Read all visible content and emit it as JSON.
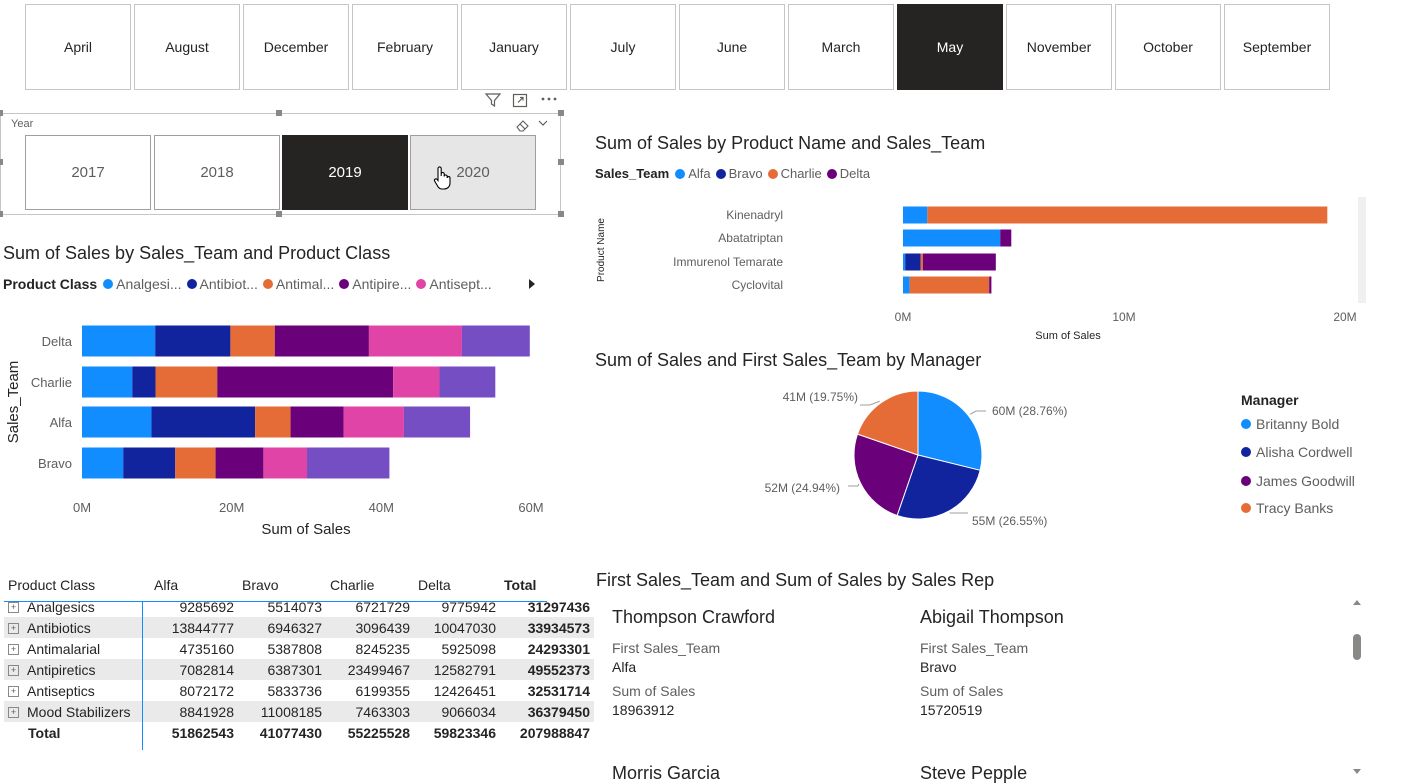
{
  "months": {
    "items": [
      "April",
      "August",
      "December",
      "February",
      "January",
      "July",
      "June",
      "March",
      "May",
      "November",
      "October",
      "September"
    ],
    "selected": "May"
  },
  "year_slicer": {
    "label": "Year",
    "years": [
      "2017",
      "2018",
      "2019",
      "2020"
    ],
    "selected": "2019",
    "hovered": "2020"
  },
  "toolbar_icons": [
    "filter-icon",
    "focus-mode-icon",
    "more-options-icon"
  ],
  "team_class_chart": {
    "title": "Sum of Sales by Sales_Team and Product Class",
    "legend_title": "Product Class",
    "legend_items": [
      "Analgesi...",
      "Antibiot...",
      "Antimal...",
      "Antipire...",
      "Antisept..."
    ],
    "ylabel": "Sales_Team",
    "xlabel": "Sum of Sales",
    "ticks": [
      "0M",
      "20M",
      "40M",
      "60M"
    ]
  },
  "product_chart": {
    "title": "Sum of Sales by Product Name and Sales_Team",
    "legend_title": "Sales_Team",
    "legend_items": [
      "Alfa",
      "Bravo",
      "Charlie",
      "Delta"
    ],
    "ylabel": "Product Name",
    "xlabel": "Sum of Sales",
    "ticks": [
      "0M",
      "10M",
      "20M"
    ]
  },
  "pie_chart": {
    "title": "Sum of Sales and First Sales_Team by Manager",
    "legend_title": "Manager",
    "labels": [
      "60M (28.76%)",
      "55M (26.55%)",
      "52M (24.94%)",
      "41M (19.75%)"
    ]
  },
  "matrix": {
    "headers": [
      "Product Class",
      "Alfa",
      "Bravo",
      "Charlie",
      "Delta",
      "Total"
    ],
    "rows": [
      [
        "Analgesics",
        "9285692",
        "5514073",
        "6721729",
        "9775942",
        "31297436"
      ],
      [
        "Antibiotics",
        "13844777",
        "6946327",
        "3096439",
        "10047030",
        "33934573"
      ],
      [
        "Antimalarial",
        "4735160",
        "5387808",
        "8245235",
        "5925098",
        "24293301"
      ],
      [
        "Antipiretics",
        "7082814",
        "6387301",
        "23499467",
        "12582791",
        "49552373"
      ],
      [
        "Antiseptics",
        "8072172",
        "5833736",
        "6199355",
        "12426451",
        "32531714"
      ],
      [
        "Mood Stabilizers",
        "8841928",
        "11008185",
        "7463303",
        "9066034",
        "36379450"
      ]
    ],
    "total": [
      "Total",
      "51862543",
      "41077430",
      "55225528",
      "59823346",
      "207988847"
    ]
  },
  "cards": {
    "title": "First Sales_Team and Sum of Sales by Sales Rep",
    "team_label": "First Sales_Team",
    "sales_label": "Sum of Sales",
    "reps": [
      {
        "name": "Thompson Crawford",
        "team": "Alfa",
        "sales": "18963912"
      },
      {
        "name": "Abigail Thompson",
        "team": "Bravo",
        "sales": "15720519"
      },
      {
        "name": "Morris Garcia",
        "team": "",
        "sales": ""
      },
      {
        "name": "Steve Pepple",
        "team": "",
        "sales": ""
      }
    ]
  },
  "colors": {
    "blue": "#118DFF",
    "navy": "#12239E",
    "orange": "#E66C37",
    "purple": "#6B007B",
    "pink": "#E044A7",
    "violet": "#744EC2",
    "dark": "#252423"
  },
  "chart_data": [
    {
      "type": "bar",
      "title": "Sum of Sales by Sales_Team and Product Class",
      "orientation": "horizontal-stacked",
      "categories": [
        "Delta",
        "Charlie",
        "Alfa",
        "Bravo"
      ],
      "series": [
        {
          "name": "Analgesics",
          "color": "#118DFF",
          "values": [
            9.78,
            6.72,
            9.29,
            5.51
          ]
        },
        {
          "name": "Antibiotics",
          "color": "#12239E",
          "values": [
            10.05,
            3.1,
            13.84,
            6.95
          ]
        },
        {
          "name": "Antimalarial",
          "color": "#E66C37",
          "values": [
            5.93,
            8.25,
            4.74,
            5.39
          ]
        },
        {
          "name": "Antipiretics",
          "color": "#6B007B",
          "values": [
            12.58,
            23.5,
            7.08,
            6.39
          ]
        },
        {
          "name": "Antiseptics",
          "color": "#E044A7",
          "values": [
            12.43,
            6.2,
            8.07,
            5.83
          ]
        },
        {
          "name": "Mood Stabilizers",
          "color": "#744EC2",
          "values": [
            9.07,
            7.46,
            8.84,
            11.01
          ]
        }
      ],
      "xlabel": "Sum of Sales",
      "ylabel": "Sales_Team",
      "xlim": [
        0,
        60
      ],
      "unit": "M"
    },
    {
      "type": "bar",
      "title": "Sum of Sales by Product Name and Sales_Team",
      "orientation": "horizontal-stacked",
      "categories": [
        "Kinenadryl",
        "Abatatriptan",
        "Immurenol Temarate",
        "Cyclovital"
      ],
      "series": [
        {
          "name": "Alfa",
          "color": "#118DFF",
          "values": [
            1.1,
            4.4,
            0.1,
            0.3
          ]
        },
        {
          "name": "Bravo",
          "color": "#12239E",
          "values": [
            0,
            0,
            0.7,
            0
          ]
        },
        {
          "name": "Charlie",
          "color": "#E66C37",
          "values": [
            18.1,
            0,
            0.1,
            3.6
          ]
        },
        {
          "name": "Delta",
          "color": "#6B007B",
          "values": [
            0,
            0.5,
            3.3,
            0.1
          ]
        }
      ],
      "xlabel": "Sum of Sales",
      "ylabel": "Product Name",
      "xlim": [
        0,
        21
      ],
      "unit": "M"
    },
    {
      "type": "pie",
      "title": "Sum of Sales and First Sales_Team by Manager",
      "slices": [
        {
          "name": "Britanny Bold",
          "value": 60,
          "percent": 28.76,
          "color": "#118DFF"
        },
        {
          "name": "Alisha Cordwell",
          "value": 55,
          "percent": 26.55,
          "color": "#12239E"
        },
        {
          "name": "James Goodwill",
          "value": 52,
          "percent": 24.94,
          "color": "#6B007B"
        },
        {
          "name": "Tracy Banks",
          "value": 41,
          "percent": 19.75,
          "color": "#E66C37"
        }
      ]
    }
  ]
}
